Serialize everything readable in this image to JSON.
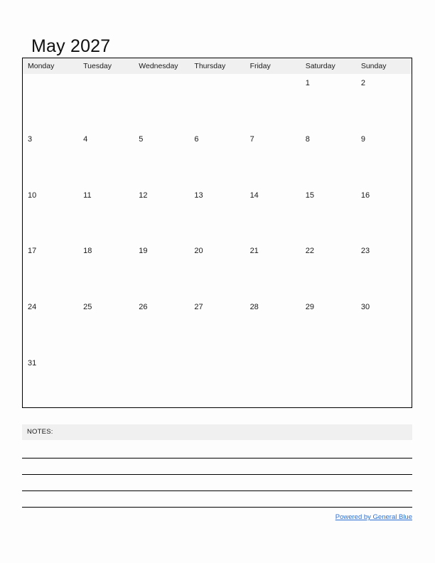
{
  "document": {
    "type": "printable-monthly-calendar",
    "title": "May 2027",
    "month": "May",
    "year": "2027",
    "background_color": "#fdfdfd",
    "border_color": "#000000",
    "header_background": "#f0f0f0"
  },
  "calendar": {
    "weekday_headers": [
      "Monday",
      "Tuesday",
      "Wednesday",
      "Thursday",
      "Friday",
      "Saturday",
      "Sunday"
    ],
    "weeks": [
      {
        "days": [
          "",
          "",
          "",
          "",
          "",
          "1",
          "2"
        ]
      },
      {
        "days": [
          "3",
          "4",
          "5",
          "6",
          "7",
          "8",
          "9"
        ]
      },
      {
        "days": [
          "10",
          "11",
          "12",
          "13",
          "14",
          "15",
          "16"
        ]
      },
      {
        "days": [
          "17",
          "18",
          "19",
          "20",
          "21",
          "22",
          "23"
        ]
      },
      {
        "days": [
          "24",
          "25",
          "26",
          "27",
          "28",
          "29",
          "30"
        ]
      },
      {
        "days": [
          "31",
          "",
          "",
          "",
          "",
          "",
          ""
        ]
      }
    ]
  },
  "notes": {
    "label": "NOTES:",
    "line_count": 4
  },
  "footer": {
    "link_text": "Powered by General Blue",
    "link_color": "#2a6ed1"
  }
}
